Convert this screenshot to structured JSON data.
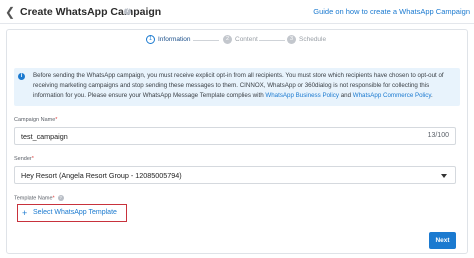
{
  "header": {
    "back_icon": "chevron-left-icon",
    "title": "Create WhatsApp Campaign",
    "help_icon": "help-circle-icon",
    "guide_link": "Guide on how to create a WhatsApp Campaign"
  },
  "steps": [
    {
      "number": "1",
      "label": "Information",
      "active": true
    },
    {
      "number": "2",
      "label": "Content",
      "active": false
    },
    {
      "number": "3",
      "label": "Schedule",
      "active": false
    }
  ],
  "notice": {
    "icon": "info-icon",
    "text_before": "Before sending the WhatsApp campaign, you must receive explicit opt-in from all recipients. You must store which recipients have chosen to opt-out of receiving marketing campaigns and stop sending these messages to them. CINNOX, WhatsApp or 360dialog is not responsible for collecting this information for you. Please ensure your WhatsApp Message Template complies with ",
    "link1": "WhatsApp Business Policy",
    "text_middle": " and ",
    "link2": "WhatsApp Commerce Policy",
    "text_after": "."
  },
  "form": {
    "campaign_name": {
      "label": "Campaign Name",
      "required_mark": "*",
      "value": "test_campaign",
      "counter": "13/100"
    },
    "sender": {
      "label": "Sender",
      "required_mark": "*",
      "value": "Hey Resort (Angela Resort Group - 12085005794)"
    },
    "template_name": {
      "label": "Template Name",
      "required_mark": "*",
      "button_label": "Select WhatsApp Template"
    }
  },
  "actions": {
    "next_label": "Next"
  },
  "colors": {
    "accent": "#1b7ad0",
    "notice_bg": "#e8f3fc",
    "highlight_border": "#c8323c"
  }
}
